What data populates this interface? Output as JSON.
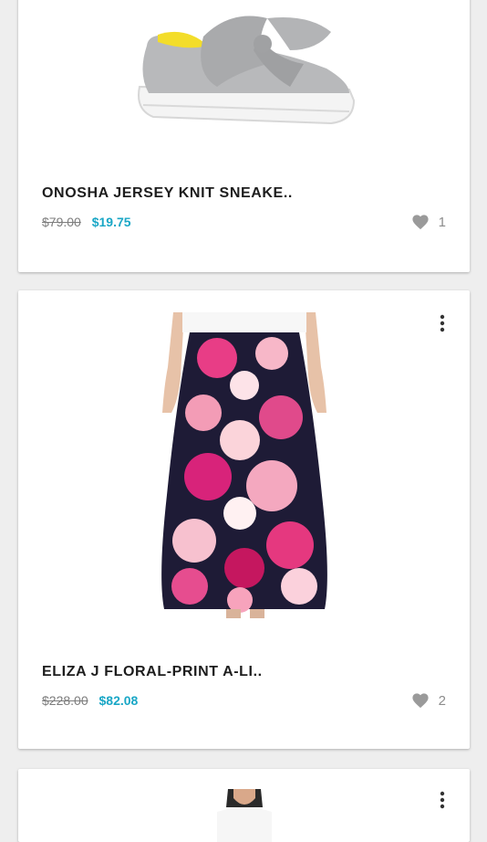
{
  "products": [
    {
      "title": "ONOSHA JERSEY KNIT SNEAKE..",
      "original_price": "$79.00",
      "sale_price": "$19.75",
      "likes": "1",
      "image_icon": "shoe-image"
    },
    {
      "title": "ELIZA J FLORAL-PRINT A-LI..",
      "original_price": "$228.00",
      "sale_price": "$82.08",
      "likes": "2",
      "image_icon": "skirt-image"
    },
    {
      "title": "",
      "image_icon": "top-image"
    }
  ],
  "icons": {
    "like": "heart-icon",
    "menu": "more-vertical-icon"
  },
  "colors": {
    "sale_price": "#1aa7c6",
    "original_price": "#7d7d7d",
    "background": "#eeeeee",
    "card": "#ffffff"
  }
}
